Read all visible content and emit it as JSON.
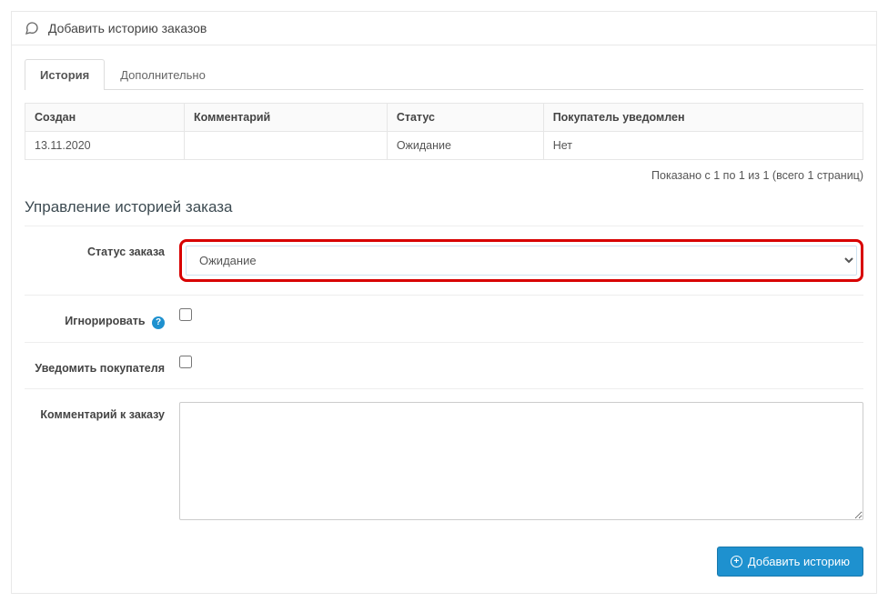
{
  "header": {
    "title": "Добавить историю заказов"
  },
  "tabs": [
    {
      "label": "История",
      "active": true
    },
    {
      "label": "Дополнительно",
      "active": false
    }
  ],
  "table": {
    "columns": [
      "Создан",
      "Комментарий",
      "Статус",
      "Покупатель уведомлен"
    ],
    "rows": [
      {
        "created": "13.11.2020",
        "comment": "",
        "status": "Ожидание",
        "notified": "Нет"
      }
    ]
  },
  "pagination": "Показано с 1 по 1 из 1 (всего 1 страниц)",
  "section_title": "Управление историей заказа",
  "form": {
    "status_label": "Статус заказа",
    "status_value": "Ожидание",
    "ignore_label": "Игнорировать",
    "notify_label": "Уведомить покупателя",
    "comment_label": "Комментарий к заказу",
    "submit_label": "Добавить историю"
  }
}
